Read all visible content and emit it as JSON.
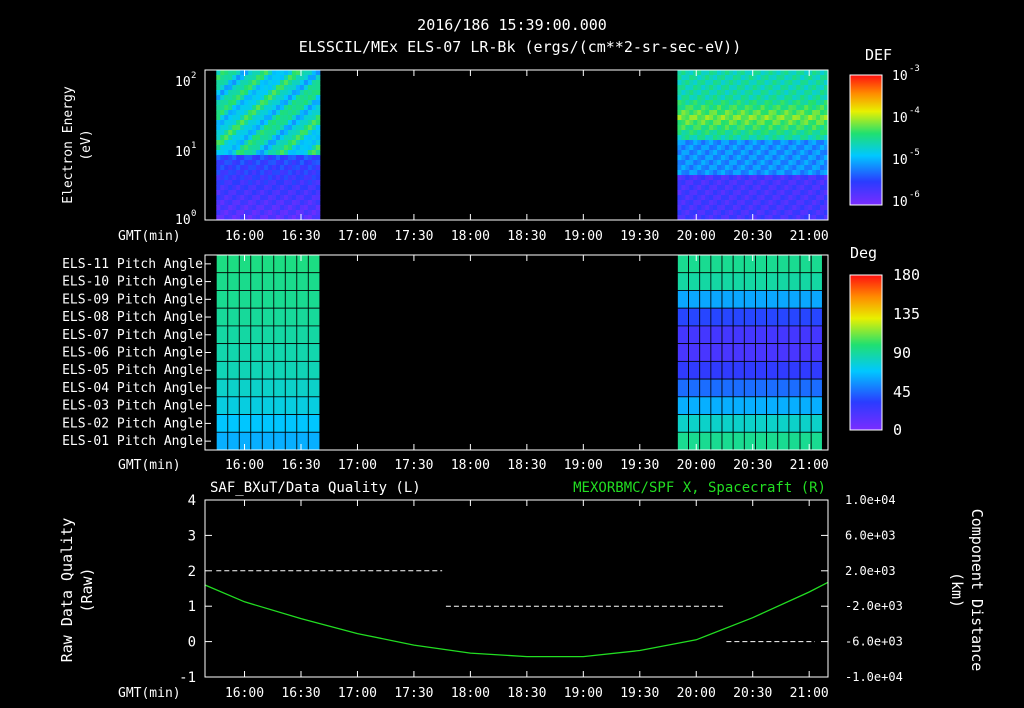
{
  "header": {
    "time": "2016/186 15:39:00.000",
    "product": "ELSSCIL/MEx ELS-07 LR-Bk  (ergs/(cm**2-sr-sec-eV))"
  },
  "time_axis": {
    "label": "GMT(min)",
    "ticks": [
      "16:00",
      "16:30",
      "17:00",
      "17:30",
      "18:00",
      "18:30",
      "19:00",
      "19:30",
      "20:00",
      "20:30",
      "21:00"
    ]
  },
  "colors": {
    "background": "#000000",
    "axis": "#ffffff",
    "green_trace": "#22dd22"
  },
  "chart_data": [
    {
      "type": "heatmap",
      "title": "",
      "ylabel": [
        "Electron Energy",
        "(eV)"
      ],
      "yscale": "log",
      "ylim": [
        1,
        150
      ],
      "yticks": [
        {
          "base": "10",
          "exp": "2",
          "value": 100
        },
        {
          "base": "10",
          "exp": "1",
          "value": 10
        },
        {
          "base": "10",
          "exp": "0",
          "value": 1
        }
      ],
      "xlim": [
        "15:39",
        "21:10"
      ],
      "data_intervals": [
        [
          "15:45",
          "16:40"
        ],
        [
          "19:50",
          "21:10"
        ]
      ],
      "colorbar": {
        "title": "DEF",
        "ticks": [
          {
            "base": "10",
            "exp": "-3"
          },
          {
            "base": "10",
            "exp": "-4"
          },
          {
            "base": "10",
            "exp": "-5"
          },
          {
            "base": "10",
            "exp": "-6"
          }
        ]
      }
    },
    {
      "type": "heatmap",
      "title": "",
      "rows": [
        "ELS-11 Pitch Angle",
        "ELS-10 Pitch Angle",
        "ELS-09 Pitch Angle",
        "ELS-08 Pitch Angle",
        "ELS-07 Pitch Angle",
        "ELS-06 Pitch Angle",
        "ELS-05 Pitch Angle",
        "ELS-04 Pitch Angle",
        "ELS-03 Pitch Angle",
        "ELS-02 Pitch Angle",
        "ELS-01 Pitch Angle"
      ],
      "xlim": [
        "15:39",
        "21:10"
      ],
      "blocks": [
        {
          "start": "15:45",
          "end": "16:40",
          "values_deg": [
            95,
            93,
            92,
            90,
            88,
            86,
            84,
            80,
            75,
            68,
            62
          ]
        },
        {
          "start": "19:50",
          "end": "21:07",
          "values_deg": [
            92,
            88,
            60,
            35,
            22,
            20,
            30,
            45,
            62,
            80,
            92
          ]
        }
      ],
      "colorbar": {
        "title": "Deg",
        "ticks": [
          "180",
          "135",
          "90",
          "45",
          "0"
        ],
        "range": [
          0,
          180
        ]
      }
    },
    {
      "type": "line",
      "title_left": "SAF_BXuT/Data Quality (L)",
      "title_right": "MEXORBMC/SPF X, Spacecraft (R)",
      "ylabel_left": [
        "Raw Data Quality",
        "(Raw)"
      ],
      "ylabel_right": [
        "Component Distance",
        "(km)"
      ],
      "ylim_left": [
        -1,
        4
      ],
      "yticks_left": [
        "4",
        "3",
        "2",
        "1",
        "0",
        "-1"
      ],
      "ylim_right": [
        -10000,
        10000
      ],
      "yticks_right": [
        "1.0e+04",
        "6.0e+03",
        "2.0e+03",
        "-2.0e+03",
        "-6.0e+03",
        "-1.0e+04"
      ],
      "xlim": [
        "15:39",
        "21:10"
      ],
      "series": [
        {
          "axis": "left",
          "style": "dashed",
          "points": [
            [
              "15:45",
              2
            ],
            [
              "17:45",
              2
            ],
            [
              "17:47",
              1
            ],
            [
              "20:15",
              1
            ],
            [
              "20:16",
              0
            ],
            [
              "21:03",
              0
            ]
          ]
        },
        {
          "axis": "right",
          "style": "solid",
          "points": [
            [
              "15:39",
              400
            ],
            [
              "16:00",
              -1500
            ],
            [
              "16:30",
              -3400
            ],
            [
              "17:00",
              -5100
            ],
            [
              "17:30",
              -6400
            ],
            [
              "18:00",
              -7300
            ],
            [
              "18:30",
              -7700
            ],
            [
              "19:00",
              -7700
            ],
            [
              "19:30",
              -7000
            ],
            [
              "20:00",
              -5800
            ],
            [
              "20:30",
              -3300
            ],
            [
              "21:00",
              -400
            ],
            [
              "21:10",
              700
            ]
          ]
        }
      ]
    }
  ]
}
